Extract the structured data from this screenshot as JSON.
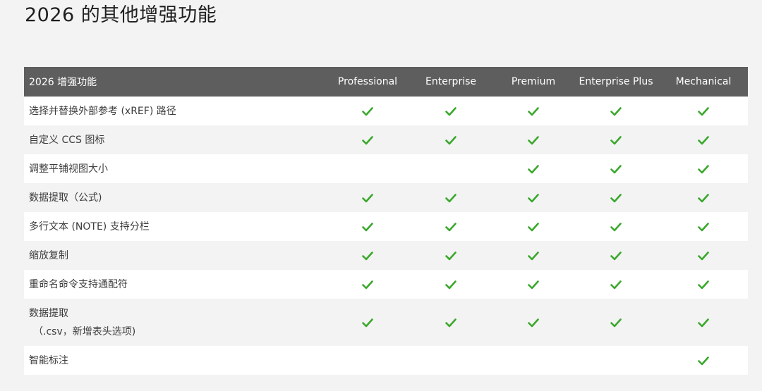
{
  "page": {
    "title": "2026 的其他增强功能"
  },
  "table": {
    "feature_header": "2026 增强功能",
    "editions": [
      "Professional",
      "Enterprise",
      "Premium",
      "Enterprise Plus",
      "Mechanical"
    ],
    "check_icon": "check-icon",
    "check_color": "#3aa82c",
    "rows": [
      {
        "feature": "选择并替换外部参考 (xREF) 路径",
        "support": [
          true,
          true,
          true,
          true,
          true
        ]
      },
      {
        "feature": "自定义 CCS 图标",
        "support": [
          true,
          true,
          true,
          true,
          true
        ]
      },
      {
        "feature": "调整平铺视图大小",
        "support": [
          false,
          false,
          true,
          true,
          true
        ]
      },
      {
        "feature": "数据提取（公式)",
        "support": [
          true,
          true,
          true,
          true,
          true
        ]
      },
      {
        "feature": "多行文本 (NOTE) 支持分栏",
        "support": [
          true,
          true,
          true,
          true,
          true
        ]
      },
      {
        "feature": "缩放复制",
        "support": [
          true,
          true,
          true,
          true,
          true
        ]
      },
      {
        "feature": "重命名命令支持通配符",
        "support": [
          true,
          true,
          true,
          true,
          true
        ]
      },
      {
        "feature": "数据提取",
        "feature_line2": "（.csv，新增表头选项)",
        "support": [
          true,
          true,
          true,
          true,
          true
        ]
      },
      {
        "feature": "智能标注",
        "support": [
          false,
          false,
          false,
          false,
          true
        ]
      }
    ]
  }
}
